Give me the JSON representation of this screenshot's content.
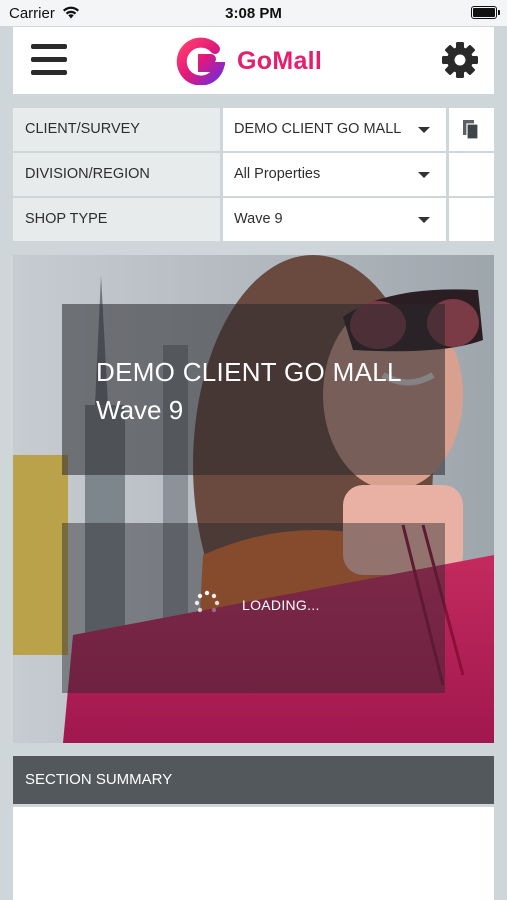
{
  "status_bar": {
    "carrier": "Carrier",
    "time": "3:08 PM"
  },
  "header": {
    "logo_text": "GoMall",
    "brand_color": "#e51e6e",
    "menu_icon": "hamburger-menu-icon",
    "settings_icon": "gear-icon"
  },
  "filters": [
    {
      "label": "CLIENT/SURVEY",
      "value": "DEMO CLIENT GO MALL",
      "extra_icon": "copy-icon"
    },
    {
      "label": "DIVISION/REGION",
      "value": "All Properties"
    },
    {
      "label": "SHOP TYPE",
      "value": "Wave 9"
    }
  ],
  "hero": {
    "title": "DEMO CLIENT GO MALL",
    "subtitle": "Wave 9",
    "loading_text": "LOADING..."
  },
  "section": {
    "title": "SECTION SUMMARY"
  }
}
